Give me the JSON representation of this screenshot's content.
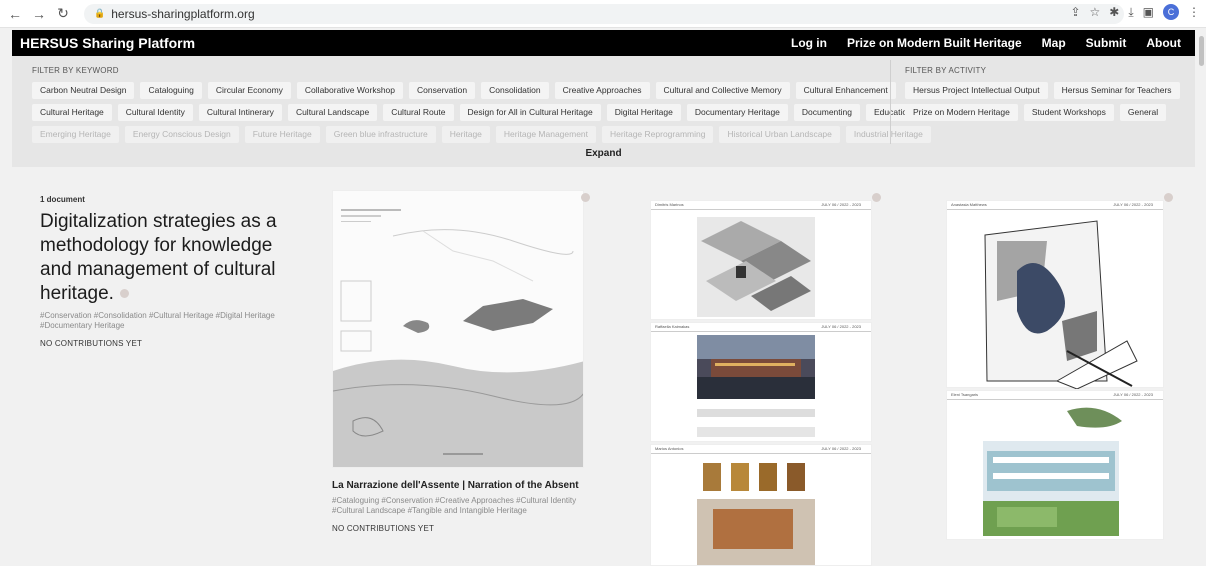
{
  "browser": {
    "url": "hersus-sharingplatform.org",
    "profile_initial": "C"
  },
  "topbar": {
    "brand": "HERSUS Sharing Platform",
    "nav": [
      "Log in",
      "Prize on Modern Built Heritage",
      "Map",
      "Submit",
      "About"
    ]
  },
  "filters": {
    "keyword_label": "FILTER BY KEYWORD",
    "keyword_rows": [
      [
        "Carbon Neutral Design",
        "Cataloguing",
        "Circular Economy",
        "Collaborative Workshop",
        "Conservation",
        "Consolidation",
        "Creative Approaches",
        "Cultural and Collective Memory",
        "Cultural Enhancement"
      ],
      [
        "Cultural Heritage",
        "Cultural Identity",
        "Cultural Intinerary",
        "Cultural Landscape",
        "Cultural Route",
        "Design for All in Cultural Heritage",
        "Digital Heritage",
        "Documentary Heritage",
        "Documenting",
        "Education"
      ],
      [
        "Emerging Heritage",
        "Energy Conscious Design",
        "Future Heritage",
        "Green blue infrastructure",
        "Heritage",
        "Heritage Management",
        "Heritage Reprogramming",
        "Historical Urban Landscape",
        "Industrial Heritage"
      ]
    ],
    "activity_label": "FILTER BY ACTIVITY",
    "activity_rows": [
      [
        "Hersus Project Intellectual Output",
        "Hersus Seminar for Teachers"
      ],
      [
        "Prize on Modern Heritage",
        "Student Workshops",
        "General"
      ]
    ],
    "expand_label": "Expand"
  },
  "cards": [
    {
      "count": "1 document",
      "title": "Digitalization strategies as a methodology for knowledge and management of cultural heritage.",
      "tags": "#Conservation #Consolidation #Cultural Heritage #Digital Heritage #Documentary Heritage",
      "status": "NO CONTRIBUTIONS YET"
    },
    {
      "title": "La Narrazione dell'Assente | Narration of the Absent",
      "tags": "#Cataloguing #Conservation #Creative Approaches #Cultural Identity #Cultural Landscape #Tangible and Intangible Heritage",
      "status": "NO CONTRIBUTIONS YET"
    }
  ],
  "sheets": [
    {
      "author": "Dimitris Marinos",
      "meta": "JULY 06 / 2022 - 2023"
    },
    {
      "author": "Raffaella Kaimakas",
      "meta": "JULY 06 / 2022 - 2023"
    },
    {
      "author": "Marios Antonios",
      "meta": "JULY 06 / 2022 - 2023"
    },
    {
      "author": "Anastasia Matthews",
      "meta": "JULY 06 / 2022 - 2023"
    },
    {
      "author": "Eleni Tsangaris",
      "meta": "JULY 06 / 2022 - 2023"
    }
  ]
}
